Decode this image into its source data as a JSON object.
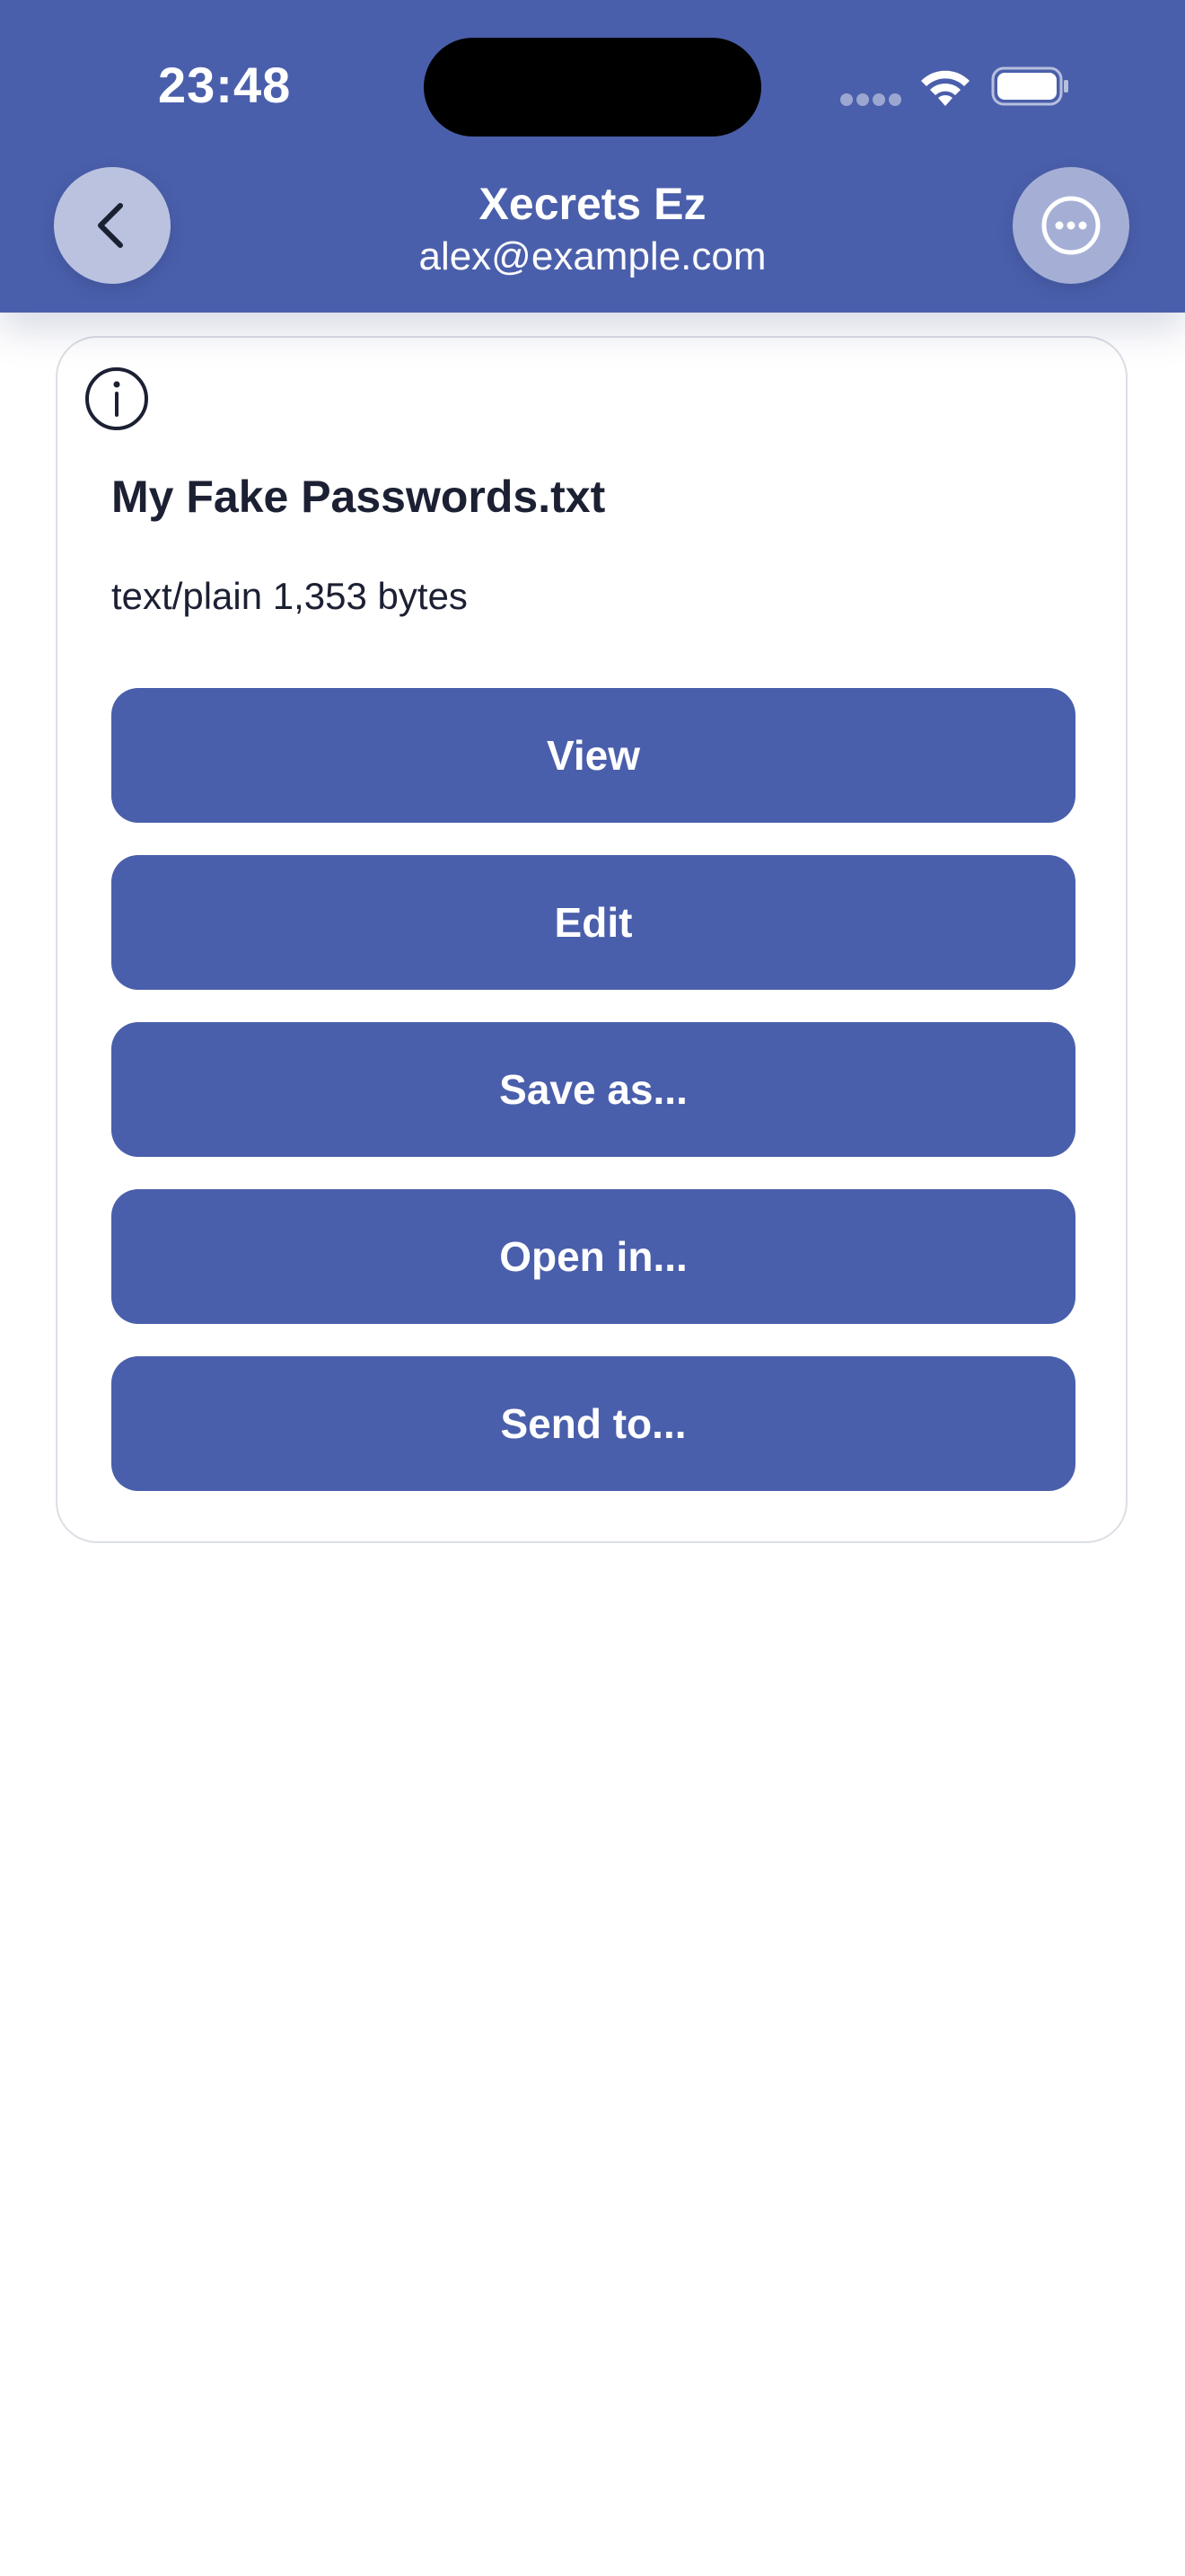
{
  "status_bar": {
    "time": "23:48"
  },
  "header": {
    "title": "Xecrets Ez",
    "subtitle": "alex@example.com",
    "back_icon": "chevron-left-icon",
    "more_icon": "ellipsis-circle-icon"
  },
  "file": {
    "name": "My Fake Passwords.txt",
    "meta": "text/plain 1,353 bytes",
    "info_icon": "info-circle-icon"
  },
  "actions": [
    {
      "label": "View"
    },
    {
      "label": "Edit"
    },
    {
      "label": "Save as..."
    },
    {
      "label": "Open in..."
    },
    {
      "label": "Send to..."
    }
  ],
  "colors": {
    "brand": "#4a5fab",
    "text": "#1c2033",
    "card_border": "#dcdee6"
  }
}
